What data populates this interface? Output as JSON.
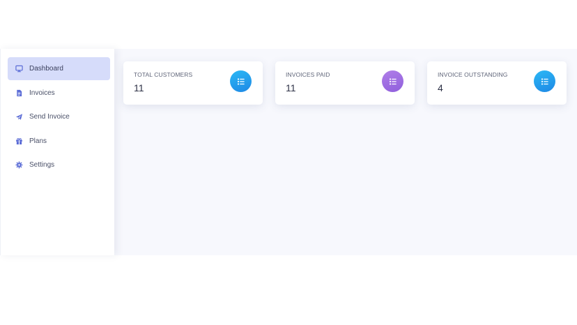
{
  "sidebar": {
    "items": [
      {
        "label": "Dashboard",
        "icon": "monitor-icon",
        "active": true
      },
      {
        "label": "Invoices",
        "icon": "document-icon",
        "active": false
      },
      {
        "label": "Send Invoice",
        "icon": "paper-plane-icon",
        "active": false
      },
      {
        "label": "Plans",
        "icon": "gift-icon",
        "active": false
      },
      {
        "label": "Settings",
        "icon": "gear-icon",
        "active": false
      }
    ]
  },
  "cards": [
    {
      "label": "TOTAL CUSTOMERS",
      "value": "11",
      "icon": "list-icon",
      "color": "#1e88e5"
    },
    {
      "label": "INVOICES PAID",
      "value": "11",
      "icon": "list-icon",
      "color": "#9b6be0"
    },
    {
      "label": "INVOICE OUTSTANDING",
      "value": "4",
      "icon": "list-icon",
      "color": "#1e88e5"
    }
  ],
  "colors": {
    "accent": "#5b6cd6",
    "active_bg": "#d6dcfa",
    "main_bg": "#f7f8fd"
  }
}
